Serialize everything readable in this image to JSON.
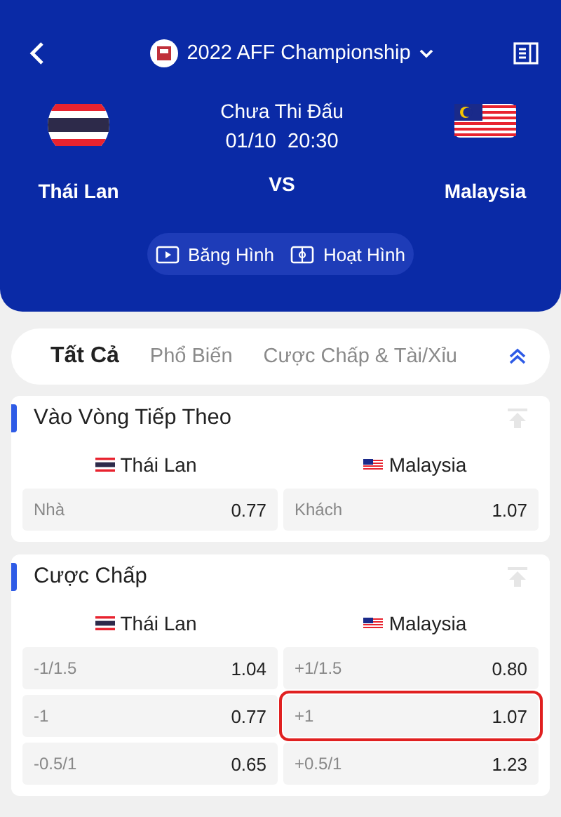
{
  "header": {
    "league": "2022 AFF Championship",
    "status": "Chưa Thi Đấu",
    "date": "01/10",
    "time": "20:30",
    "vs": "VS",
    "home": {
      "name": "Thái Lan"
    },
    "away": {
      "name": "Malaysia"
    },
    "media": [
      {
        "kind": "video",
        "label": "Băng Hình"
      },
      {
        "kind": "animation",
        "label": "Hoạt Hình"
      }
    ]
  },
  "tabs": [
    {
      "label": "Tất Cả",
      "selected": true
    },
    {
      "label": "Phổ Biến",
      "selected": false
    },
    {
      "label": "Cược Chấp & Tài/Xỉu",
      "selected": false
    }
  ],
  "markets": [
    {
      "title": "Vào Vòng Tiếp Theo",
      "home": {
        "name": "Thái Lan"
      },
      "away": {
        "name": "Malaysia"
      },
      "rows": [
        [
          {
            "label": "Nhà",
            "odds": "0.77",
            "highlighted": false
          },
          {
            "label": "Khách",
            "odds": "1.07",
            "highlighted": false
          }
        ]
      ]
    },
    {
      "title": "Cược Chấp",
      "home": {
        "name": "Thái Lan"
      },
      "away": {
        "name": "Malaysia"
      },
      "rows": [
        [
          {
            "label": "-1/1.5",
            "odds": "1.04",
            "highlighted": false
          },
          {
            "label": "+1/1.5",
            "odds": "0.80",
            "highlighted": false
          }
        ],
        [
          {
            "label": "-1",
            "odds": "0.77",
            "highlighted": false
          },
          {
            "label": "+1",
            "odds": "1.07",
            "highlighted": true
          }
        ],
        [
          {
            "label": "-0.5/1",
            "odds": "0.65",
            "highlighted": false
          },
          {
            "label": "+0.5/1",
            "odds": "1.23",
            "highlighted": false
          }
        ]
      ]
    }
  ]
}
